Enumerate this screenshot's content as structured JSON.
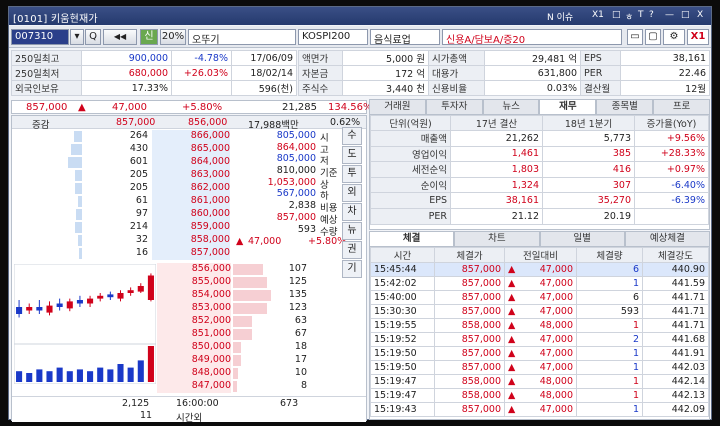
{
  "title": "[0101] 키움현재가",
  "titlebar_right": [
    "N 이슈",
    "X1",
    "□",
    "ㅎ",
    "T",
    "?",
    "—",
    "□",
    "X"
  ],
  "toolbar": {
    "code": "007310",
    "dropdown": "▾",
    "search": "Q",
    "sound": "◀◀",
    "nav_btn": "신",
    "pct": "20%",
    "name": "오뚜기",
    "market": "KOSPI200",
    "sector": "음식료업",
    "credit": "신용A/담보A/증20",
    "x1": "X1"
  },
  "info_left": [
    {
      "label": "250일최고",
      "price": "900,000",
      "pct": "-4.78%",
      "date": "17/06/09",
      "cls": "dn"
    },
    {
      "label": "250일최저",
      "price": "680,000",
      "pct": "+26.03%",
      "date": "18/02/14",
      "cls": "up"
    },
    {
      "label": "외국인보유",
      "price": "17.33%",
      "pct": "",
      "date": "596(천)",
      "cls": "blk"
    }
  ],
  "info_mid": [
    {
      "label": "액면가",
      "value": "5,000 원",
      "label2": "시가총액",
      "value2": "29,481 억",
      "label3": "EPS",
      "value3": "38,161"
    },
    {
      "label": "자본금",
      "value": "172 억",
      "label2": "대용가",
      "value2": "631,800",
      "label3": "PER",
      "value3": "22.46"
    },
    {
      "label": "주식수",
      "value": "3,440 천",
      "label2": "신용비율",
      "value2": "0.03%",
      "label3": "결산월",
      "value3": "12월"
    }
  ],
  "price_bar": {
    "price": "857,000",
    "arrow": "▲",
    "change": "47,000",
    "pct": "+5.80%",
    "volume": "21,285",
    "ratio": "134.56%"
  },
  "ob_header": {
    "label": "증감",
    "price1": "857,000",
    "price2": "856,000",
    "tv": "17,988백만",
    "pct": "0.62%"
  },
  "asks": [
    {
      "inc": "264",
      "price": "866,000",
      "w": 0.12
    },
    {
      "inc": "430",
      "price": "865,000",
      "w": 0.15
    },
    {
      "inc": "601",
      "price": "864,000",
      "w": 0.2
    },
    {
      "inc": "205",
      "price": "863,000",
      "w": 0.1
    },
    {
      "inc": "205",
      "price": "862,000",
      "w": 0.1
    },
    {
      "inc": "61",
      "price": "861,000",
      "w": 0.06
    },
    {
      "inc": "97",
      "price": "860,000",
      "w": 0.08
    },
    {
      "inc": "214",
      "price": "859,000",
      "w": 0.1
    },
    {
      "inc": "32",
      "price": "858,000",
      "w": 0.05
    },
    {
      "inc": "16",
      "price": "857,000",
      "w": 0.04
    }
  ],
  "summary": [
    {
      "v": "805,000",
      "l": "시",
      "cls": "dn"
    },
    {
      "v": "864,000",
      "l": "고",
      "cls": "up"
    },
    {
      "v": "805,000",
      "l": "저",
      "cls": "dn"
    },
    {
      "v": "810,000",
      "l": "기준",
      "cls": "blk"
    },
    {
      "v": "1,053,000",
      "l": "상",
      "cls": "up"
    },
    {
      "v": "567,000",
      "l": "하",
      "cls": "dn"
    },
    {
      "v": "2,838",
      "l": "비용",
      "cls": "blk"
    },
    {
      "v": "857,000",
      "l": "예상",
      "cls": "up"
    },
    {
      "v": "593",
      "l": "수량",
      "cls": "blk"
    }
  ],
  "exp_row": {
    "arrow": "▲",
    "change": "47,000",
    "pct": "+5.80%"
  },
  "side_buttons": [
    "수",
    "도",
    "투",
    "외",
    "차",
    "뉴",
    "권",
    "기"
  ],
  "bids": [
    {
      "price": "856,000",
      "qty": "107",
      "w": 0.4
    },
    {
      "price": "855,000",
      "qty": "125",
      "w": 0.45
    },
    {
      "price": "854,000",
      "qty": "135",
      "w": 0.5
    },
    {
      "price": "853,000",
      "qty": "123",
      "w": 0.45
    },
    {
      "price": "852,000",
      "qty": "63",
      "w": 0.25
    },
    {
      "price": "851,000",
      "qty": "67",
      "w": 0.25
    },
    {
      "price": "850,000",
      "qty": "18",
      "w": 0.1
    },
    {
      "price": "849,000",
      "qty": "17",
      "w": 0.1
    },
    {
      "price": "848,000",
      "qty": "10",
      "w": 0.06
    },
    {
      "price": "847,000",
      "qty": "8",
      "w": 0.05
    }
  ],
  "ob_footer": {
    "left1": "2,125",
    "right1": "673",
    "left2": "11",
    "time": "16:00:00",
    "sub": "시간외"
  },
  "chart_ohlc": [
    [
      0.5,
      0.4,
      0.6,
      0.35
    ],
    [
      0.45,
      0.5,
      0.55,
      0.4
    ],
    [
      0.5,
      0.45,
      0.6,
      0.4
    ],
    [
      0.42,
      0.52,
      0.58,
      0.38
    ],
    [
      0.55,
      0.5,
      0.62,
      0.45
    ],
    [
      0.48,
      0.58,
      0.62,
      0.44
    ],
    [
      0.6,
      0.55,
      0.66,
      0.5
    ],
    [
      0.55,
      0.62,
      0.66,
      0.5
    ],
    [
      0.62,
      0.66,
      0.7,
      0.58
    ],
    [
      0.68,
      0.64,
      0.72,
      0.6
    ],
    [
      0.62,
      0.7,
      0.74,
      0.58
    ],
    [
      0.7,
      0.74,
      0.78,
      0.66
    ],
    [
      0.72,
      0.8,
      0.84,
      0.7
    ],
    [
      0.6,
      0.95,
      0.98,
      0.58
    ]
  ],
  "chart_vol": [
    0.3,
    0.25,
    0.35,
    0.3,
    0.4,
    0.3,
    0.35,
    0.3,
    0.4,
    0.35,
    0.5,
    0.4,
    0.6,
    1.0
  ],
  "right_tabs": [
    "거래원",
    "투자자",
    "뉴스",
    "재무",
    "종목별",
    "프로"
  ],
  "fin": {
    "header": [
      "단위(억원)",
      "17년 결산",
      "18년 1분기",
      "증가율(YoY)"
    ],
    "rows": [
      {
        "l": "매출액",
        "a": "21,262",
        "b": "5,773",
        "c": "+9.56%",
        "cc": "up",
        "ac": "blk",
        "bc": "blk"
      },
      {
        "l": "영업이익",
        "a": "1,461",
        "b": "385",
        "c": "+28.33%",
        "cc": "up",
        "ac": "up",
        "bc": "up"
      },
      {
        "l": "세전순익",
        "a": "1,803",
        "b": "416",
        "c": "+0.97%",
        "cc": "up",
        "ac": "up",
        "bc": "up"
      },
      {
        "l": "순이익",
        "a": "1,324",
        "b": "307",
        "c": "-6.40%",
        "cc": "dn",
        "ac": "up",
        "bc": "up"
      },
      {
        "l": "EPS",
        "a": "38,161",
        "b": "35,270",
        "c": "-6.39%",
        "cc": "dn",
        "ac": "up",
        "bc": "up"
      },
      {
        "l": "PER",
        "a": "21.12",
        "b": "20.19",
        "c": "",
        "cc": "blk",
        "ac": "blk",
        "bc": "blk"
      }
    ]
  },
  "trade_tabs": [
    "체결",
    "차트",
    "일별",
    "예상체결"
  ],
  "trade_header": [
    "시간",
    "체결가",
    "전일대비",
    "체결량",
    "체결강도"
  ],
  "trades": [
    {
      "t": "15:45:44",
      "p": "857,000",
      "c": "47,000",
      "q": "6",
      "s": "440.90",
      "qc": "dn",
      "hl": true
    },
    {
      "t": "15:42:02",
      "p": "857,000",
      "c": "47,000",
      "q": "1",
      "s": "441.59",
      "qc": "dn",
      "hl": false
    },
    {
      "t": "15:40:00",
      "p": "857,000",
      "c": "47,000",
      "q": "6",
      "s": "441.71",
      "qc": "blk",
      "hl": false
    },
    {
      "t": "15:30:30",
      "p": "857,000",
      "c": "47,000",
      "q": "593",
      "s": "441.71",
      "qc": "blk",
      "hl": false
    },
    {
      "t": "15:19:55",
      "p": "858,000",
      "c": "48,000",
      "q": "1",
      "s": "441.71",
      "qc": "up",
      "hl": false
    },
    {
      "t": "15:19:52",
      "p": "857,000",
      "c": "47,000",
      "q": "2",
      "s": "441.68",
      "qc": "dn",
      "hl": false
    },
    {
      "t": "15:19:50",
      "p": "857,000",
      "c": "47,000",
      "q": "1",
      "s": "441.91",
      "qc": "dn",
      "hl": false
    },
    {
      "t": "15:19:50",
      "p": "857,000",
      "c": "47,000",
      "q": "1",
      "s": "442.03",
      "qc": "dn",
      "hl": false
    },
    {
      "t": "15:19:47",
      "p": "858,000",
      "c": "48,000",
      "q": "1",
      "s": "442.14",
      "qc": "up",
      "hl": false
    },
    {
      "t": "15:19:47",
      "p": "858,000",
      "c": "48,000",
      "q": "1",
      "s": "442.13",
      "qc": "up",
      "hl": false
    },
    {
      "t": "15:19:43",
      "p": "857,000",
      "c": "47,000",
      "q": "1",
      "s": "442.09",
      "qc": "dn",
      "hl": false
    }
  ]
}
